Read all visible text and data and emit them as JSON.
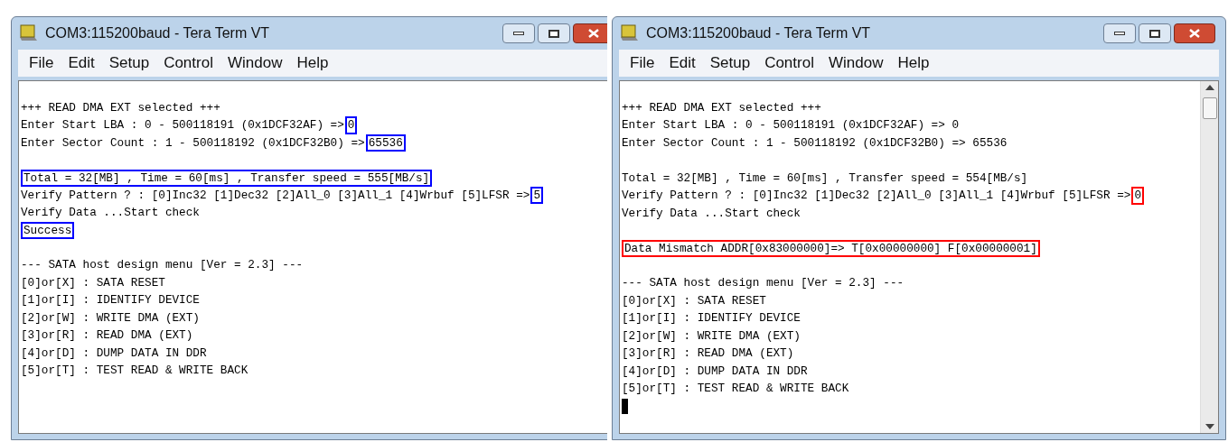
{
  "windows": [
    {
      "title": "COM3:115200baud - Tera Term VT",
      "menu": [
        "File",
        "Edit",
        "Setup",
        "Control",
        "Window",
        "Help"
      ],
      "blocks": [
        [
          {
            "segments": [
              {
                "text": "+++ READ DMA EXT selected +++"
              }
            ]
          },
          {
            "segments": [
              {
                "text": "Enter Start LBA : 0 - 500118191 (0x1DCF32AF) =>"
              },
              {
                "text": "0",
                "color": "#0000ff"
              }
            ]
          },
          {
            "segments": [
              {
                "text": "Enter Sector Count : 1 - 500118192 (0x1DCF32B0) =>"
              },
              {
                "text": "65536",
                "color": "#0000ff"
              }
            ]
          }
        ],
        [
          {
            "segments": [
              {
                "text": "Total = 32[MB] , Time = 60[ms] , Transfer speed = 555[MB/s]",
                "color": "#0000ff"
              }
            ]
          },
          {
            "segments": [
              {
                "text": "Verify Pattern ? : [0]Inc32 [1]Dec32 [2]All_0 [3]All_1 [4]Wrbuf [5]LFSR =>"
              },
              {
                "text": "5",
                "color": "#0000ff"
              }
            ]
          },
          {
            "segments": [
              {
                "text": "Verify Data ...Start check"
              }
            ]
          },
          {
            "segments": [
              {
                "text": "Success",
                "color": "#0000ff"
              }
            ]
          }
        ],
        [
          {
            "segments": [
              {
                "text": "--- SATA host design menu [Ver = 2.3] ---"
              }
            ]
          },
          {
            "segments": [
              {
                "text": "[0]or[X] : SATA RESET"
              }
            ]
          },
          {
            "segments": [
              {
                "text": "[1]or[I] : IDENTIFY DEVICE"
              }
            ]
          },
          {
            "segments": [
              {
                "text": "[2]or[W] : WRITE DMA (EXT)"
              }
            ]
          },
          {
            "segments": [
              {
                "text": "[3]or[R] : READ DMA (EXT)"
              }
            ]
          },
          {
            "segments": [
              {
                "text": "[4]or[D] : DUMP DATA IN DDR"
              }
            ]
          },
          {
            "segments": [
              {
                "text": "[5]or[T] : TEST READ & WRITE BACK"
              }
            ]
          }
        ]
      ]
    },
    {
      "title": "COM3:115200baud - Tera Term VT",
      "menu": [
        "File",
        "Edit",
        "Setup",
        "Control",
        "Window",
        "Help"
      ],
      "cursor": true,
      "scrollbar": true,
      "blocks": [
        [
          {
            "segments": [
              {
                "text": "+++ READ DMA EXT selected +++"
              }
            ]
          },
          {
            "segments": [
              {
                "text": "Enter Start LBA : 0 - 500118191 (0x1DCF32AF) => 0"
              }
            ]
          },
          {
            "segments": [
              {
                "text": "Enter Sector Count : 1 - 500118192 (0x1DCF32B0) => 65536"
              }
            ]
          }
        ],
        [
          {
            "segments": [
              {
                "text": "Total = 32[MB] , Time = 60[ms] , Transfer speed = 554[MB/s]"
              }
            ]
          },
          {
            "segments": [
              {
                "text": "Verify Pattern ? : [0]Inc32 [1]Dec32 [2]All_0 [3]All_1 [4]Wrbuf [5]LFSR =>"
              },
              {
                "text": "0",
                "color": "#ff0000"
              }
            ]
          },
          {
            "segments": [
              {
                "text": "Verify Data ...Start check"
              }
            ]
          }
        ],
        [
          {
            "segments": [
              {
                "text": "Data Mismatch ADDR[0x83000000]=> T[0x00000000] F[0x00000001]",
                "color": "#ff0000"
              }
            ]
          }
        ],
        [
          {
            "segments": [
              {
                "text": "--- SATA host design menu [Ver = 2.3] ---"
              }
            ]
          },
          {
            "segments": [
              {
                "text": "[0]or[X] : SATA RESET"
              }
            ]
          },
          {
            "segments": [
              {
                "text": "[1]or[I] : IDENTIFY DEVICE"
              }
            ]
          },
          {
            "segments": [
              {
                "text": "[2]or[W] : WRITE DMA (EXT)"
              }
            ]
          },
          {
            "segments": [
              {
                "text": "[3]or[R] : READ DMA (EXT)"
              }
            ]
          },
          {
            "segments": [
              {
                "text": "[4]or[D] : DUMP DATA IN DDR"
              }
            ]
          },
          {
            "segments": [
              {
                "text": "[5]or[T] : TEST READ & WRITE BACK"
              }
            ]
          }
        ]
      ]
    }
  ]
}
